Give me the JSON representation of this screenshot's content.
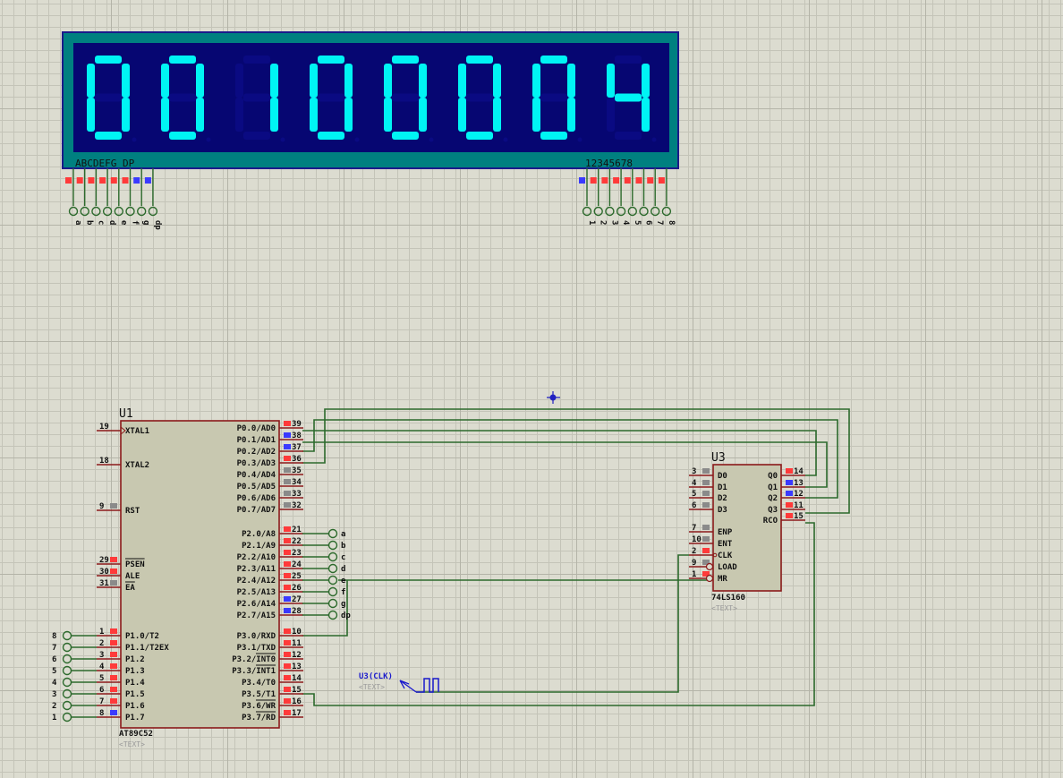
{
  "colors": {
    "pin_high": "#ff3a3a",
    "pin_low": "#3a3aff",
    "pin_float": "#8a8a8a",
    "wire": "#2c6a2c",
    "segment_on": "#00f4f4",
    "segment_off": "#0a0a82"
  },
  "display": {
    "digits": "00100004",
    "segment_label": "ABCDEFG DP",
    "digit_label": "12345678",
    "seg_pins": [
      {
        "label": "a",
        "state": "high"
      },
      {
        "label": "b",
        "state": "high"
      },
      {
        "label": "c",
        "state": "high"
      },
      {
        "label": "d",
        "state": "high"
      },
      {
        "label": "e",
        "state": "high"
      },
      {
        "label": "f",
        "state": "high"
      },
      {
        "label": "g",
        "state": "low"
      },
      {
        "label": "dp",
        "state": "low"
      }
    ],
    "digit_pins": [
      {
        "label": "1",
        "state": "low"
      },
      {
        "label": "2",
        "state": "high"
      },
      {
        "label": "3",
        "state": "high"
      },
      {
        "label": "4",
        "state": "high"
      },
      {
        "label": "5",
        "state": "high"
      },
      {
        "label": "6",
        "state": "high"
      },
      {
        "label": "7",
        "state": "high"
      },
      {
        "label": "8",
        "state": "high"
      }
    ]
  },
  "u1": {
    "ref": "U1",
    "part": "AT89C52",
    "text": "<TEXT>",
    "left_pins": [
      {
        "name": "XTAL1",
        "num": "19",
        "state": "none"
      },
      {
        "name": "XTAL2",
        "num": "18",
        "state": "none"
      },
      {
        "name": "RST",
        "num": "9",
        "state": "float"
      },
      {
        "name": "PSEN",
        "num": "29",
        "state": "high"
      },
      {
        "name": "ALE",
        "num": "30",
        "state": "high"
      },
      {
        "name": "EA",
        "num": "31",
        "state": "float"
      },
      {
        "name": "P1.0/T2",
        "num": "1",
        "state": "high"
      },
      {
        "name": "P1.1/T2EX",
        "num": "2",
        "state": "high"
      },
      {
        "name": "P1.2",
        "num": "3",
        "state": "high"
      },
      {
        "name": "P1.3",
        "num": "4",
        "state": "high"
      },
      {
        "name": "P1.4",
        "num": "5",
        "state": "high"
      },
      {
        "name": "P1.5",
        "num": "6",
        "state": "high"
      },
      {
        "name": "P1.6",
        "num": "7",
        "state": "high"
      },
      {
        "name": "P1.7",
        "num": "8",
        "state": "low"
      }
    ],
    "right_pins": [
      {
        "name": "P0.0/AD0",
        "num": "39",
        "state": "high"
      },
      {
        "name": "P0.1/AD1",
        "num": "38",
        "state": "low"
      },
      {
        "name": "P0.2/AD2",
        "num": "37",
        "state": "low"
      },
      {
        "name": "P0.3/AD3",
        "num": "36",
        "state": "high"
      },
      {
        "name": "P0.4/AD4",
        "num": "35",
        "state": "float"
      },
      {
        "name": "P0.5/AD5",
        "num": "34",
        "state": "float"
      },
      {
        "name": "P0.6/AD6",
        "num": "33",
        "state": "float"
      },
      {
        "name": "P0.7/AD7",
        "num": "32",
        "state": "float"
      },
      {
        "name": "P2.0/A8",
        "num": "21",
        "state": "high"
      },
      {
        "name": "P2.1/A9",
        "num": "22",
        "state": "high"
      },
      {
        "name": "P2.2/A10",
        "num": "23",
        "state": "high"
      },
      {
        "name": "P2.3/A11",
        "num": "24",
        "state": "high"
      },
      {
        "name": "P2.4/A12",
        "num": "25",
        "state": "high"
      },
      {
        "name": "P2.5/A13",
        "num": "26",
        "state": "high"
      },
      {
        "name": "P2.6/A14",
        "num": "27",
        "state": "low"
      },
      {
        "name": "P2.7/A15",
        "num": "28",
        "state": "low"
      },
      {
        "name": "P3.0/RXD",
        "num": "10",
        "state": "high"
      },
      {
        "name": "P3.1/TXD",
        "num": "11",
        "state": "high"
      },
      {
        "name": "P3.2/INT0",
        "num": "12",
        "state": "high"
      },
      {
        "name": "P3.3/INT1",
        "num": "13",
        "state": "high"
      },
      {
        "name": "P3.4/T0",
        "num": "14",
        "state": "high"
      },
      {
        "name": "P3.5/T1",
        "num": "15",
        "state": "high"
      },
      {
        "name": "P3.6/WR",
        "num": "16",
        "state": "high"
      },
      {
        "name": "P3.7/RD",
        "num": "17",
        "state": "high"
      }
    ],
    "p2_terminals": [
      "a",
      "b",
      "c",
      "d",
      "e",
      "f",
      "g",
      "dp"
    ],
    "p1_terminals": [
      "8",
      "7",
      "6",
      "5",
      "4",
      "3",
      "2",
      "1"
    ]
  },
  "u3": {
    "ref": "U3",
    "part": "74LS160",
    "text": "<TEXT>",
    "left_pins": [
      {
        "name": "D0",
        "num": "3",
        "state": "float"
      },
      {
        "name": "D1",
        "num": "4",
        "state": "float"
      },
      {
        "name": "D2",
        "num": "5",
        "state": "float"
      },
      {
        "name": "D3",
        "num": "6",
        "state": "float"
      },
      {
        "name": "ENP",
        "num": "7",
        "state": "float"
      },
      {
        "name": "ENT",
        "num": "10",
        "state": "float"
      },
      {
        "name": "CLK",
        "num": "2",
        "state": "high"
      },
      {
        "name": "LOAD",
        "num": "9",
        "state": "float"
      },
      {
        "name": "MR",
        "num": "1",
        "state": "high"
      }
    ],
    "right_pins": [
      {
        "name": "Q0",
        "num": "14",
        "state": "high"
      },
      {
        "name": "Q1",
        "num": "13",
        "state": "low"
      },
      {
        "name": "Q2",
        "num": "12",
        "state": "low"
      },
      {
        "name": "Q3",
        "num": "11",
        "state": "high"
      },
      {
        "name": "RCO",
        "num": "15",
        "state": "high"
      }
    ]
  },
  "clock": {
    "label": "U3(CLK)",
    "text": "<TEXT>"
  }
}
